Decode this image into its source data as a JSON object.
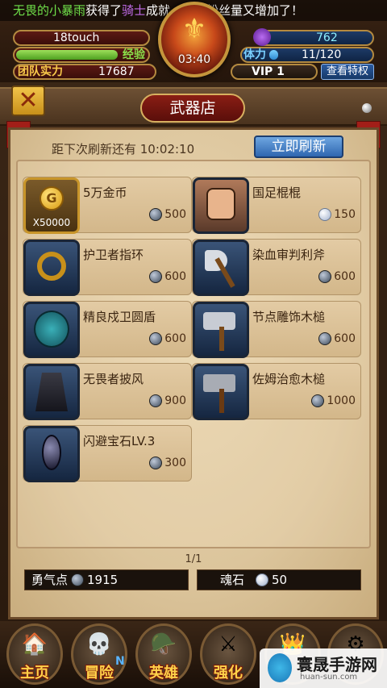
{
  "ticker": {
    "player": "无畏的小暴雨",
    "action": "获得了",
    "role": "骑士",
    "rest": "成就，他的粉丝量又增加了！"
  },
  "top": {
    "name_value": "18touch",
    "exp_label": "经验",
    "exp_fill": 0.78,
    "power_label": "团队实力",
    "power_value": "17687",
    "soul_value": "762",
    "stamina_label": "体力",
    "stamina_value": "11/120",
    "stamina_fill": 0.09,
    "timer": "03:40",
    "vip": "VIP  1",
    "vip_btn": "查看特权"
  },
  "shop": {
    "title": "武器店",
    "refresh_text": "距下次刷新还有   10:02:10",
    "refresh_btn": "立即刷新",
    "items": [
      {
        "name": "5万金币",
        "price": "500",
        "currency": "soul-coin",
        "qty": "X50000",
        "icon": "gold-coin-icon"
      },
      {
        "name": "国足棍棍",
        "price": "150",
        "currency": "gem",
        "icon": "hero-portrait-icon"
      },
      {
        "name": "护卫者指环",
        "price": "600",
        "currency": "soul-coin",
        "icon": "ring-icon"
      },
      {
        "name": "染血审判利斧",
        "price": "600",
        "currency": "soul-coin",
        "icon": "axe-icon"
      },
      {
        "name": "精良戍卫圆盾",
        "price": "600",
        "currency": "soul-coin",
        "icon": "shield-icon"
      },
      {
        "name": "节点雕饰木槌",
        "price": "600",
        "currency": "soul-coin",
        "icon": "mallet-icon"
      },
      {
        "name": "无畏者披风",
        "price": "900",
        "currency": "soul-coin",
        "icon": "cloak-icon"
      },
      {
        "name": "佐姆治愈木槌",
        "price": "1000",
        "currency": "soul-coin",
        "icon": "hammer-icon"
      },
      {
        "name": "闪避宝石LV.3",
        "price": "300",
        "currency": "soul-coin",
        "icon": "gem-stone-icon"
      }
    ],
    "page": "1/1",
    "courage_label": "勇气点",
    "courage_value": "1915",
    "soulstone_label": "魂石",
    "soulstone_value": "50"
  },
  "nav": [
    {
      "label": "主页",
      "icon": "home-icon"
    },
    {
      "label": "冒险",
      "icon": "skull-icon",
      "badge": "N"
    },
    {
      "label": "英雄",
      "icon": "helmet-icon"
    },
    {
      "label": "强化",
      "icon": "sword-icon"
    },
    {
      "label": "",
      "icon": "character-icon"
    },
    {
      "label": "",
      "icon": "gear-icon"
    }
  ],
  "watermark": {
    "title": "寰晟手游网",
    "url": "huan-sun.com"
  }
}
